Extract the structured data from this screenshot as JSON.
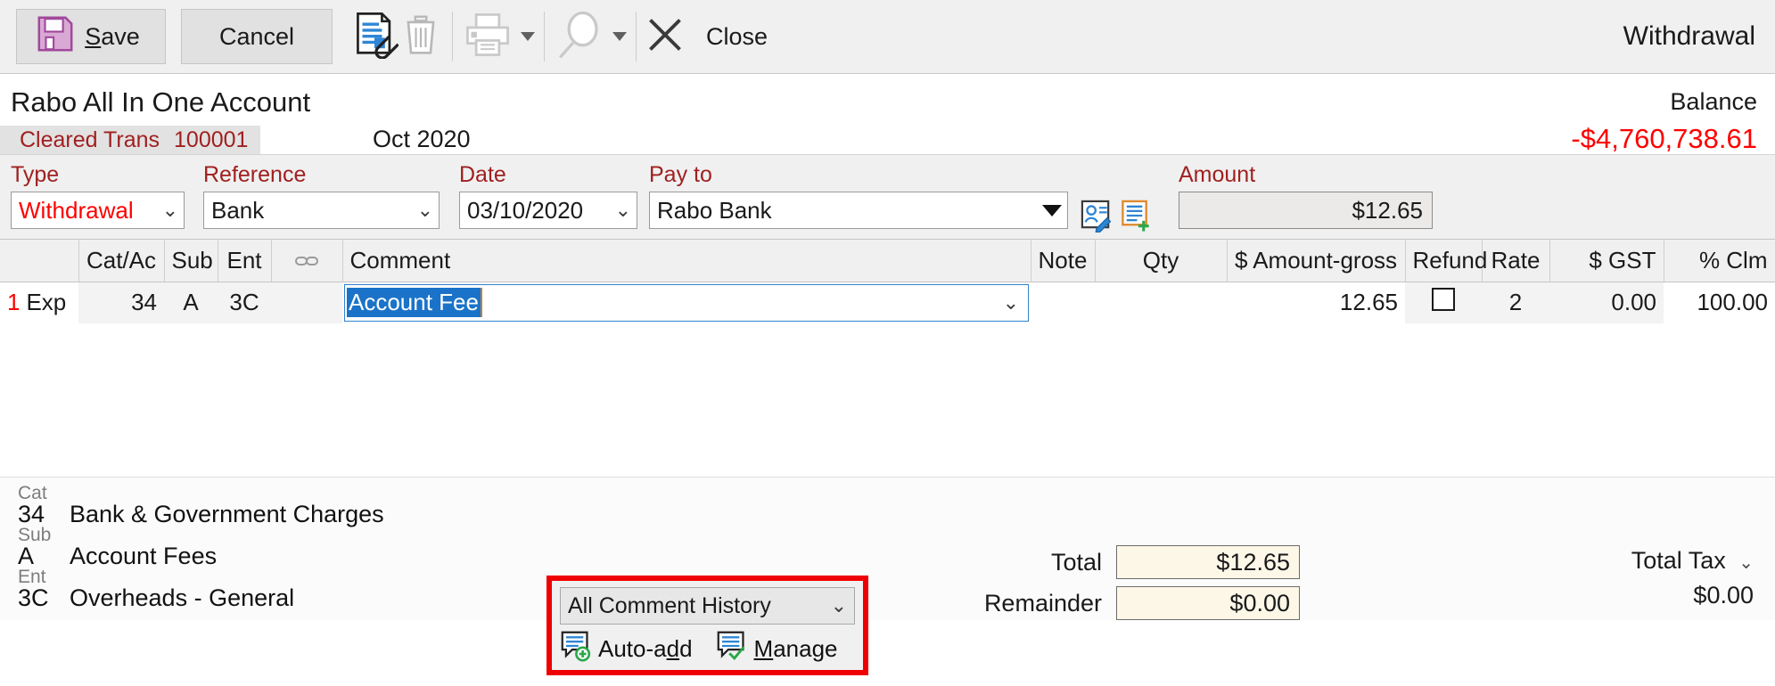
{
  "toolbar": {
    "save_label": "Save",
    "cancel_label": "Cancel",
    "close_label": "Close",
    "attach_icon": "document-attachment-icon",
    "delete_icon": "trash-icon",
    "print_icon": "printer-icon",
    "search_icon": "magnifier-icon",
    "close_icon": "close-x-icon",
    "document_type": "Withdrawal"
  },
  "account": {
    "name": "Rabo All In One Account",
    "balance_label": "Balance",
    "balance_value": "-$4,760,738.61",
    "balance_color": "#fe0000",
    "tab_label": "Cleared Trans",
    "tab_number": "100001",
    "period": "Oct 2020"
  },
  "form": {
    "type": {
      "label": "Type",
      "value": "Withdrawal"
    },
    "reference": {
      "label": "Reference",
      "value": "Bank"
    },
    "date": {
      "label": "Date",
      "value": "03/10/2020"
    },
    "payto": {
      "label": "Pay to",
      "value": "Rabo Bank"
    },
    "amount": {
      "label": "Amount",
      "value": "$12.65"
    },
    "contact_icon": "contact-edit-icon",
    "addnote_icon": "add-note-icon"
  },
  "grid": {
    "columns": [
      {
        "key": "rownum",
        "label": ""
      },
      {
        "key": "catac",
        "label": "Cat/Ac"
      },
      {
        "key": "sub",
        "label": "Sub"
      },
      {
        "key": "ent",
        "label": "Ent"
      },
      {
        "key": "link",
        "label": "link-icon"
      },
      {
        "key": "comment",
        "label": "Comment"
      },
      {
        "key": "note",
        "label": "Note"
      },
      {
        "key": "qty",
        "label": "Qty"
      },
      {
        "key": "amount_gross",
        "label": "$ Amount-gross"
      },
      {
        "key": "refund",
        "label": "Refund"
      },
      {
        "key": "rate",
        "label": "Rate"
      },
      {
        "key": "gst",
        "label": "$ GST"
      },
      {
        "key": "clm",
        "label": "% Clm"
      }
    ],
    "rows": [
      {
        "rownum": "1",
        "type": "Exp",
        "catac": "34",
        "sub": "A",
        "ent": "3C",
        "link": "",
        "comment": "Account Fee",
        "note": "",
        "qty": "",
        "amount_gross": "12.65",
        "refund": false,
        "rate": "2",
        "gst": "0.00",
        "clm": "100.00"
      }
    ]
  },
  "detail": {
    "cat": {
      "tag": "Cat",
      "code": "34",
      "description": "Bank  & Government Charges"
    },
    "sub": {
      "tag": "Sub",
      "code": "A",
      "description": "Account Fees"
    },
    "ent": {
      "tag": "Ent",
      "code": "3C",
      "description": "Overheads - General"
    }
  },
  "comment_history": {
    "selected": "All Comment History",
    "autoadd_label": "Auto-add",
    "manage_label": "Manage",
    "autoadd_icon": "comment-add-icon",
    "manage_icon": "comment-check-icon",
    "highlight_color": "#ef0000"
  },
  "totals": {
    "total_label": "Total",
    "total_value": "$12.65",
    "remainder_label": "Remainder",
    "remainder_value": "$0.00",
    "total_tax_label": "Total Tax",
    "total_tax_value": "$0.00"
  }
}
